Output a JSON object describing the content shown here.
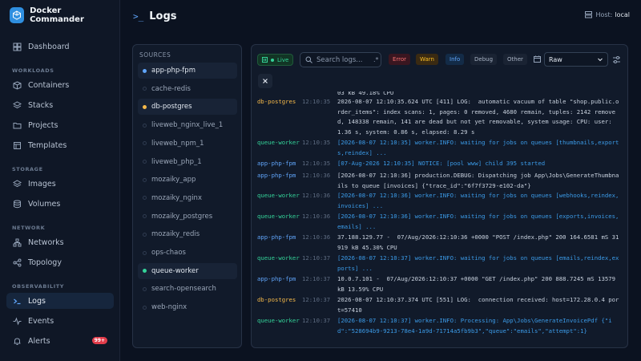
{
  "app": {
    "name": "Docker Commander"
  },
  "sidebar": {
    "dashboard": "Dashboard",
    "sections": {
      "workloads": "WORKLOADS",
      "storage": "STORAGE",
      "network": "NETWORK",
      "observability": "OBSERVABILITY"
    },
    "items": {
      "containers": "Containers",
      "stacks": "Stacks",
      "projects": "Projects",
      "templates": "Templates",
      "images": "Images",
      "volumes": "Volumes",
      "networks": "Networks",
      "topology": "Topology",
      "logs": "Logs",
      "events": "Events",
      "alerts": "Alerts"
    },
    "alerts_badge": "99+"
  },
  "header": {
    "prompt": ">_",
    "title": "Logs",
    "host_label": "Host:",
    "host_value": "local"
  },
  "sources": {
    "title": "SOURCES",
    "items": [
      {
        "name": "app-php-fpm",
        "color": "#60a5fa",
        "active": true
      },
      {
        "name": "cache-redis",
        "color": "",
        "active": false
      },
      {
        "name": "db-postgres",
        "color": "#f5b94a",
        "active": true
      },
      {
        "name": "liveweb_nginx_live_1",
        "color": "",
        "active": false
      },
      {
        "name": "liveweb_npm_1",
        "color": "",
        "active": false
      },
      {
        "name": "liveweb_php_1",
        "color": "",
        "active": false
      },
      {
        "name": "mozaiky_app",
        "color": "",
        "active": false
      },
      {
        "name": "mozaiky_nginx",
        "color": "",
        "active": false
      },
      {
        "name": "mozaiky_postgres",
        "color": "",
        "active": false
      },
      {
        "name": "mozaiky_redis",
        "color": "",
        "active": false
      },
      {
        "name": "ops-chaos",
        "color": "",
        "active": false
      },
      {
        "name": "queue-worker",
        "color": "#34d399",
        "active": true
      },
      {
        "name": "search-opensearch",
        "color": "",
        "active": false
      },
      {
        "name": "web-nginx",
        "color": "",
        "active": false
      }
    ]
  },
  "toolbar": {
    "live": "Live",
    "search_placeholder": "Search logs...",
    "regex": ".*",
    "levels": {
      "error": "Error",
      "warn": "Warn",
      "info": "Info",
      "debug": "Debug",
      "other": "Other"
    },
    "format": "Raw"
  },
  "colors": {
    "app-php-fpm": "#60a5fa",
    "db-postgres": "#f5b94a",
    "queue-worker": "#34d399"
  },
  "logs": [
    {
      "source": "",
      "time": "",
      "message": "03 kB 49.18% CPU",
      "kind": "plain"
    },
    {
      "source": "db-postgres",
      "time": "12:10:35",
      "message": "2026-08-07 12:10:35.624 UTC [411] LOG:  automatic vacuum of table \"shop.public.order_items\": index scans: 1, pages: 0 removed, 4680 remain, tuples: 2142 removed, 148338 remain, 141 are dead but not yet removable, system usage: CPU: user: 1.36 s, system: 0.86 s, elapsed: 8.29 s",
      "kind": "plain"
    },
    {
      "source": "queue-worker",
      "time": "12:10:35",
      "message": "[2026-08-07 12:10:35] worker.INFO: waiting for jobs on queues [thumbnails,exports,reindex] ...",
      "kind": "info"
    },
    {
      "source": "app-php-fpm",
      "time": "12:10:35",
      "message": "[07-Aug-2026 12:10:35] NOTICE: [pool www] child 395 started",
      "kind": "info"
    },
    {
      "source": "app-php-fpm",
      "time": "12:10:36",
      "message": "[2026-08-07 12:10:36] production.DEBUG: Dispatching job App\\Jobs\\GenerateThumbnails to queue [invoices] {\"trace_id\":\"6f7f3729-e102-da\"}",
      "kind": "plain"
    },
    {
      "source": "queue-worker",
      "time": "12:10:36",
      "message": "[2026-08-07 12:10:36] worker.INFO: waiting for jobs on queues [webhooks,reindex,invoices] ...",
      "kind": "info"
    },
    {
      "source": "queue-worker",
      "time": "12:10:36",
      "message": "[2026-08-07 12:10:36] worker.INFO: waiting for jobs on queues [exports,invoices,emails] ...",
      "kind": "info"
    },
    {
      "source": "app-php-fpm",
      "time": "12:10:36",
      "message": "37.188.129.77 -  07/Aug/2026:12:10:36 +0000 \"POST /index.php\" 200 164.6581 mS 31919 kB 45.30% CPU",
      "kind": "plain"
    },
    {
      "source": "queue-worker",
      "time": "12:10:37",
      "message": "[2026-08-07 12:10:37] worker.INFO: waiting for jobs on queues [emails,reindex,exports] ...",
      "kind": "info"
    },
    {
      "source": "app-php-fpm",
      "time": "12:10:37",
      "message": "10.0.7.101 -  07/Aug/2026:12:10:37 +0000 \"GET /index.php\" 200 888.7245 mS 13579 kB 13.59% CPU",
      "kind": "plain"
    },
    {
      "source": "db-postgres",
      "time": "12:10:37",
      "message": "2026-08-07 12:10:37.374 UTC [551] LOG:  connection received: host=172.28.0.4 port=57410",
      "kind": "plain"
    },
    {
      "source": "queue-worker",
      "time": "12:10:37",
      "message": "[2026-08-07 12:10:37] worker.INFO: Processing: App\\Jobs\\GenerateInvoicePdf {\"id\":\"528694b9-9213-78e4-1a9d-71714a5fb9b3\",\"queue\":\"emails\",\"attempt\":1}",
      "kind": "info"
    }
  ]
}
